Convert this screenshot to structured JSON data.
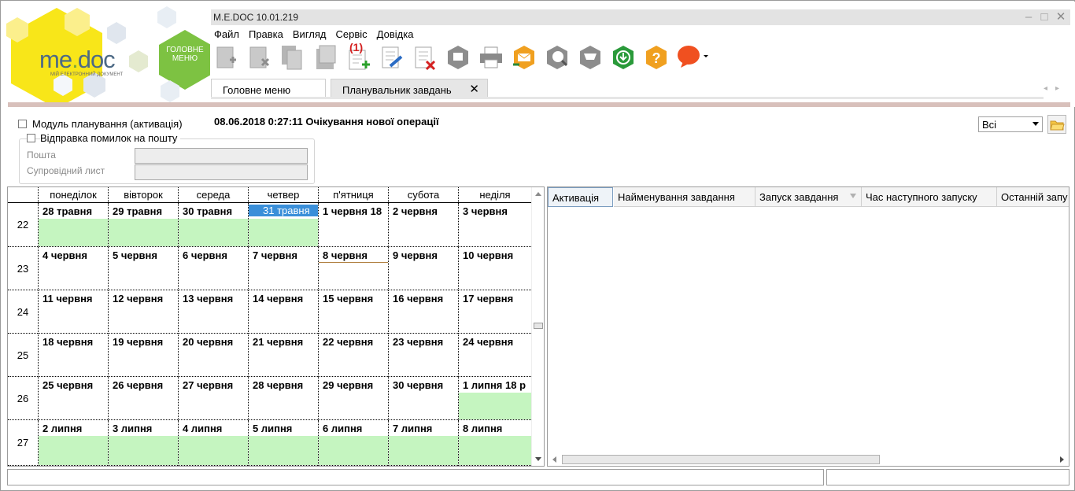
{
  "app": {
    "logo_text_left": "me",
    "logo_text_dot": ".",
    "logo_text_right": "doc",
    "logo_tagline": "МІЙ ЕЛЕКТРОННИЙ ДОКУМЕНТ",
    "main_menu_hex_label": "ГОЛОВНЕ МЕНЮ",
    "window_title": "M.E.DOC 10.01.219",
    "window_buttons": [
      "–",
      "□",
      "✕"
    ]
  },
  "menu": [
    "Файл",
    "Правка",
    "Вигляд",
    "Сервіс",
    "Довідка"
  ],
  "toolbar": {
    "icons": [
      "new-doc-icon",
      "delete-doc-icon",
      "copy-doc-icon",
      "paste-doc-icon",
      "add-plan-icon",
      "edit-icon",
      "remove-icon",
      "archive-icon",
      "print-icon",
      "send-icon",
      "receive-icon",
      "inbox-icon",
      "update-icon",
      "help-icon",
      "feedback-icon"
    ],
    "badge": "(1)"
  },
  "tabs": {
    "main": "Головне меню",
    "active": "Планувальник завдань",
    "close": "✕",
    "arrows": "◂▸"
  },
  "options": {
    "planning_module": "Модуль планування (активація)",
    "status_text": "08.06.2018 0:27:11 Очікування нової операції",
    "send_errors": "Відправка помилок на пошту",
    "mail_label": "Пошта",
    "cover_letter_label": "Супровідний лист",
    "mail_value": "",
    "cover_letter_value": "",
    "filter_value": "Всі"
  },
  "calendar": {
    "day_names": [
      "понеділок",
      "вівторок",
      "середа",
      "четвер",
      "п'ятниця",
      "субота",
      "неділя"
    ],
    "weeks": [
      {
        "num": "22",
        "days": [
          "28 травня",
          "29 травня",
          "30 травня",
          "31 травня",
          "1 червня 18",
          "2 червня",
          "3 червня"
        ]
      },
      {
        "num": "23",
        "days": [
          "4 червня",
          "5 червня",
          "6 червня",
          "7 червня",
          "8 червня",
          "9 червня",
          "10 червня"
        ]
      },
      {
        "num": "24",
        "days": [
          "11 червня",
          "12 червня",
          "13 червня",
          "14 червня",
          "15 червня",
          "16 червня",
          "17 червня"
        ]
      },
      {
        "num": "25",
        "days": [
          "18 червня",
          "19 червня",
          "20 червня",
          "21 червня",
          "22 червня",
          "23 червня",
          "24 червня"
        ]
      },
      {
        "num": "26",
        "days": [
          "25 червня",
          "26 червня",
          "27 червня",
          "28 червня",
          "29 червня",
          "30 червня",
          "1 липня 18 р"
        ]
      },
      {
        "num": "27",
        "days": [
          "2 липня",
          "3 липня",
          "4 липня",
          "5 липня",
          "6 липня",
          "7 липня",
          "8 липня"
        ]
      }
    ],
    "highlight_color": "#c5f5c0",
    "selected_color": "#3a8fd9"
  },
  "grid": {
    "columns": [
      "Активація",
      "Найменування завдання",
      "Запуск завдання",
      "Час наступного запуску",
      "Останній запу"
    ],
    "rows": []
  }
}
